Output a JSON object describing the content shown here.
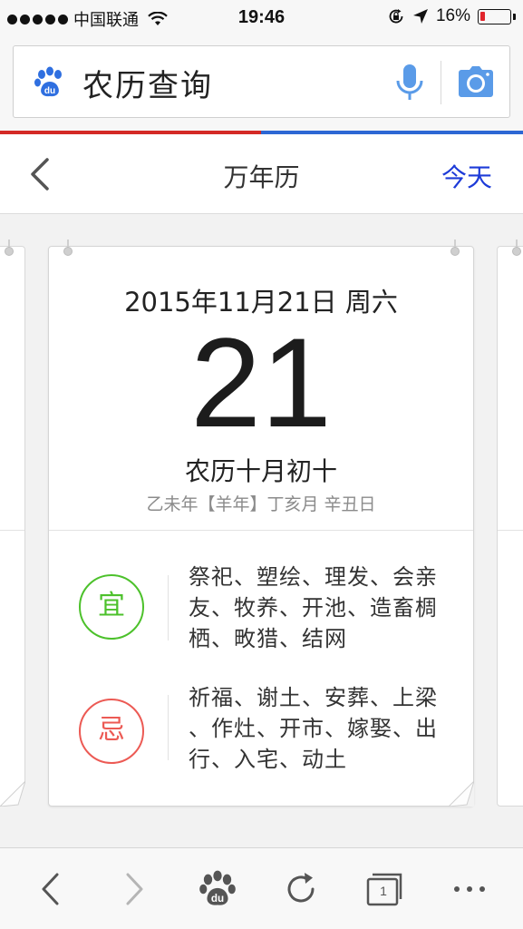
{
  "status_bar": {
    "carrier": "中国联通",
    "time": "19:46",
    "battery_percent": "16%",
    "battery_level": 0.16,
    "icons": [
      "signal-dots",
      "wifi-icon",
      "rotation-lock-icon",
      "location-arrow-icon",
      "battery-icon"
    ]
  },
  "search": {
    "query": "农历查询",
    "icons": [
      "baidu-paw-icon",
      "microphone-icon",
      "camera-icon"
    ]
  },
  "colors": {
    "accent_red": "#d42a26",
    "accent_blue": "#2d67d4",
    "today_link": "#1d3bd8",
    "yi_green": "#4cc12b",
    "ji_red": "#ec5a54",
    "battery_low": "#e0242b"
  },
  "header": {
    "title": "万年历",
    "today_label": "今天",
    "back_icon": "chevron-left-icon"
  },
  "calendar": {
    "date_line": "2015年11月21日 周六",
    "day_number": "21",
    "lunar_date": "农历十月初十",
    "ganzhi": "乙未年【羊年】丁亥月 辛丑日",
    "yi": {
      "label": "宜",
      "lines": [
        "祭祀、塑绘、理发、会亲",
        "友、牧养、开池、造畜椆",
        "栖、畋猎、结网"
      ]
    },
    "ji": {
      "label": "忌",
      "lines": [
        "祈福、谢土、安葬、上梁",
        "、作灶、开市、嫁娶、出",
        "行、入宅、动土"
      ]
    }
  },
  "toolbar": {
    "tab_count": "1",
    "buttons": [
      "back-icon",
      "forward-icon",
      "baidu-home-icon",
      "refresh-icon",
      "tabs-icon",
      "more-icon"
    ]
  }
}
